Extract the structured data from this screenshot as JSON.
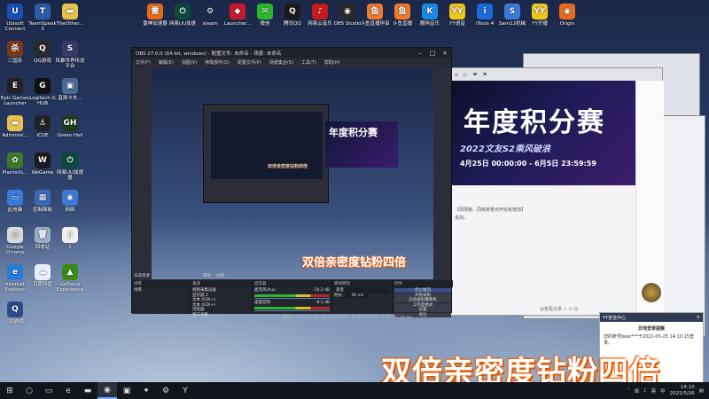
{
  "desktop_icons_left": [
    {
      "label": "Ubisoft Connect",
      "icon": "ubisoft-icon",
      "color": "#1a4fb5",
      "glyph": "U"
    },
    {
      "label": "TeamSpeak 3",
      "icon": "teamspeak-icon",
      "color": "#2a5da8",
      "glyph": "T"
    },
    {
      "label": "TheOther...",
      "icon": "folder-icon",
      "color": "#e8c04a",
      "glyph": "▬"
    },
    {
      "label": "三国杀",
      "icon": "sanguosha-icon",
      "color": "#7a3a1a",
      "glyph": "杀"
    },
    {
      "label": "QQ游戏",
      "icon": "qq-game-icon",
      "color": "#2a2a2a",
      "glyph": "Q"
    },
    {
      "label": "风暴世界传说平台",
      "icon": "storm-icon",
      "color": "#3a3a6a",
      "glyph": "S"
    },
    {
      "label": "Epic Games Launcher",
      "icon": "epic-icon",
      "color": "#222222",
      "glyph": "E"
    },
    {
      "label": "Logitech G HUB",
      "icon": "logitech-icon",
      "color": "#111111",
      "glyph": "G"
    },
    {
      "label": "直面卡车...",
      "icon": "truck-icon",
      "color": "#4a6a9a",
      "glyph": "▣"
    },
    {
      "label": "Administ...",
      "icon": "user-folder-icon",
      "color": "#e8c04a",
      "glyph": "▬"
    },
    {
      "label": "iCUE",
      "icon": "icue-icon",
      "color": "#222222",
      "glyph": "⚓"
    },
    {
      "label": "Green Hell",
      "icon": "green-hell-icon",
      "color": "#1d3a1d",
      "glyph": "GH"
    },
    {
      "label": "PlantsVs...",
      "icon": "plants-icon",
      "color": "#3a7a2a",
      "glyph": "✿"
    },
    {
      "label": "WeGame",
      "icon": "wegame-icon",
      "color": "#1a1a1a",
      "glyph": "W"
    },
    {
      "label": "网易UU加速器",
      "icon": "uu-icon",
      "color": "#0a4a3a",
      "glyph": "⏻"
    },
    {
      "label": "此电脑",
      "icon": "this-pc-icon",
      "color": "#3a7ad8",
      "glyph": "▭"
    },
    {
      "label": "控制面板",
      "icon": "control-panel-icon",
      "color": "#3a6ab8",
      "glyph": "▦"
    },
    {
      "label": "网络",
      "icon": "network-icon",
      "color": "#3a7ad8",
      "glyph": "◉"
    },
    {
      "label": "Google Chrome",
      "icon": "chrome-icon",
      "color": "#d8d8d8",
      "glyph": "◎"
    },
    {
      "label": "回收站",
      "icon": "recycle-bin-icon",
      "color": "#9ab0c8",
      "glyph": "🗑"
    },
    {
      "label": "1",
      "icon": "file-icon",
      "color": "#f0f0f0",
      "glyph": "▯"
    },
    {
      "label": "Internet Explorer",
      "icon": "ie-icon",
      "color": "#2a7ad8",
      "glyph": "e"
    },
    {
      "label": "百度网盘",
      "icon": "baidu-netdisk-icon",
      "color": "#e8f0ff",
      "glyph": "☁"
    },
    {
      "label": "GeForce Experience",
      "icon": "geforce-icon",
      "color": "#3a8a1a",
      "glyph": "▲"
    },
    {
      "label": "QQ游戏",
      "icon": "qq-game-icon",
      "color": "#2a4a8a",
      "glyph": "Q"
    }
  ],
  "desktop_icons_top": [
    {
      "label": "雷神加速器",
      "icon": "leishen-icon",
      "color": "#e86a1a",
      "glyph": "雷"
    },
    {
      "label": "网易UU加速",
      "icon": "uu-icon",
      "color": "#0a4a3a",
      "glyph": "⏻"
    },
    {
      "label": "steam",
      "icon": "steam-icon",
      "color": "#1a2a4a",
      "glyph": "⚙"
    },
    {
      "label": "Launcher...",
      "icon": "launcher-icon",
      "color": "#c81a2a",
      "glyph": "◆"
    },
    {
      "label": "微信",
      "icon": "wechat-icon",
      "color": "#2ab82a",
      "glyph": "✉"
    },
    {
      "label": "腾讯QQ",
      "icon": "qq-icon",
      "color": "#1a1a1a",
      "glyph": "Q"
    },
    {
      "label": "网易云音乐",
      "icon": "netease-music-icon",
      "color": "#c81a1a",
      "glyph": "♪"
    },
    {
      "label": "OBS Studio",
      "icon": "obs-icon",
      "color": "#2a2a2a",
      "glyph": "◉"
    },
    {
      "label": "斗鱼直播伴侣",
      "icon": "douyu-icon",
      "color": "#f07a2a",
      "glyph": "鱼"
    },
    {
      "label": "斗鱼直播",
      "icon": "douyu-live-icon",
      "color": "#f07a2a",
      "glyph": "鱼"
    },
    {
      "label": "酷狗音乐",
      "icon": "kugou-icon",
      "color": "#1a8ae8",
      "glyph": "K"
    },
    {
      "label": "YY语音",
      "icon": "yy-icon",
      "color": "#f0c81a",
      "glyph": "YY"
    },
    {
      "label": "iTools 4",
      "icon": "itools-icon",
      "color": "#1a6ad8",
      "glyph": "i"
    },
    {
      "label": "Sam12机械",
      "icon": "sam-icon",
      "color": "#3a7ad8",
      "glyph": "S"
    },
    {
      "label": "YY开播",
      "icon": "yy-live-icon",
      "color": "#f0c81a",
      "glyph": "YY"
    },
    {
      "label": "Origin",
      "icon": "origin-icon",
      "color": "#e86a1a",
      "glyph": "◉"
    }
  ],
  "obs": {
    "title": "OBS 27.0.0 (64-bit, windows) - 配置文件: 未命名 - 场景: 未命名",
    "menu": [
      "文件(F)",
      "编辑(E)",
      "视图(V)",
      "停靠部件(D)",
      "配置文件(P)",
      "场景集合(S)",
      "工具(T)",
      "帮助(H)"
    ],
    "preview_caption": "双倍亲密度钻粉四倍",
    "nested_banner_text": "年度积分赛",
    "nested_caption": "双倍亲密度钻粉四倍",
    "dock_tabs": [
      "未选择源",
      "属性",
      "滤镜"
    ],
    "scenes_header": "场景",
    "scenes": [
      "场景"
    ],
    "sources_header": "来源",
    "sources": [
      "视频采集设备",
      "显示器 2",
      "文本 (GDI+)",
      "文本 (GDI+)",
      "浏览器",
      "窗口采集"
    ],
    "mixer_header": "混音器",
    "mixer": [
      {
        "name": "麦克风/Aux",
        "db": "-10.2 dB"
      },
      {
        "name": "桌面音频",
        "db": "-8.1 dB"
      }
    ],
    "transitions_header": "转场特效",
    "transition_type": "渐变",
    "transition_duration_label": "时长",
    "transition_duration": "50 ms",
    "controls_header": "控件",
    "controls": [
      "停止推流",
      "开始录制",
      "启动虚拟摄像机",
      "工作室模式",
      "设置",
      "退出"
    ],
    "status": "丢帧 0 (0.0%)   LIVE: 00:00:00   REC: 00:00:00   CPU: 0.0%, 60.00 fps"
  },
  "browser": {
    "tabs": [
      "⌂",
      "▷",
      "❤",
      "⚑"
    ],
    "banner_title": "年度积分赛",
    "banner_sub": "2022文友S2乘风破浪",
    "banner_date": "4月25日 00:00:00 - 6月5日 23:59:59",
    "body_text_1": "【周限版、同级荣誉点开始有增加】",
    "body_text_2": "追加。",
    "bottom_text": "@查看分享  ✓  ⊙  ☺"
  },
  "notification": {
    "header": "YY安全中心",
    "title": "异地登录提醒",
    "body": "您的账号bear***于2022-05-25 14:10:15登录。"
  },
  "overlay_caption": "双倍亲密度钻粉四倍",
  "taskbar": {
    "items": [
      {
        "icon": "windows-start-icon",
        "glyph": "⊞"
      },
      {
        "icon": "search-icon",
        "glyph": "○"
      },
      {
        "icon": "task-view-icon",
        "glyph": "▭"
      },
      {
        "icon": "edge-icon",
        "glyph": "e"
      },
      {
        "icon": "file-explorer-icon",
        "glyph": "▬"
      },
      {
        "icon": "obs-taskbar-icon",
        "glyph": "◉"
      },
      {
        "icon": "store-icon",
        "glyph": "▣"
      },
      {
        "icon": "game-icon",
        "glyph": "✦"
      },
      {
        "icon": "steam-taskbar-icon",
        "glyph": "⚙"
      },
      {
        "icon": "yy-taskbar-icon",
        "glyph": "Y"
      }
    ],
    "lang": "英",
    "ime": "中",
    "time": "14:10",
    "date": "2022/5/26"
  }
}
